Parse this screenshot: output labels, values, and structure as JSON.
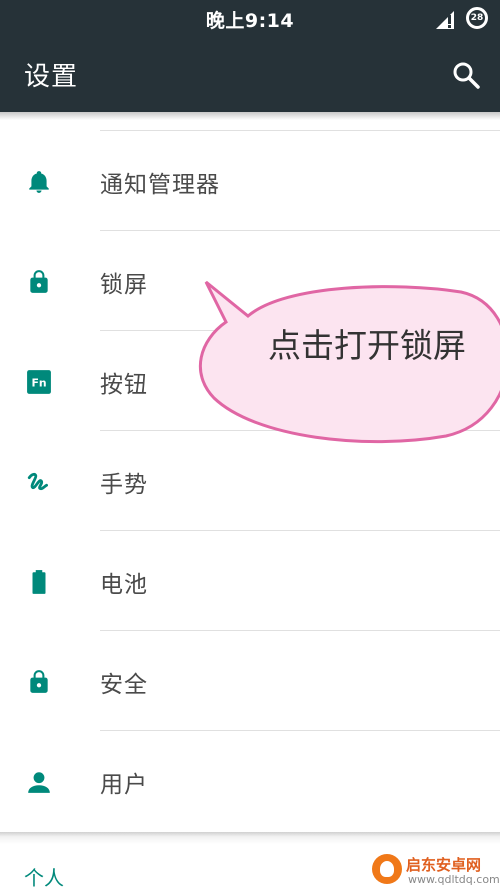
{
  "status_bar": {
    "time": "晚上9:14",
    "battery_level": "28"
  },
  "app_bar": {
    "title": "设置",
    "search_icon": "search-icon"
  },
  "items": [
    {
      "label": "通知管理器",
      "icon": "bell-icon"
    },
    {
      "label": "锁屏",
      "icon": "lock-icon"
    },
    {
      "label": "按钮",
      "icon": "fn-key-icon"
    },
    {
      "label": "手势",
      "icon": "gesture-icon"
    },
    {
      "label": "电池",
      "icon": "battery-icon"
    },
    {
      "label": "安全",
      "icon": "lock-icon"
    },
    {
      "label": "用户",
      "icon": "person-icon"
    }
  ],
  "section_header": "个人",
  "callout": {
    "text": "点击打开锁屏"
  },
  "watermark": {
    "title": "启东安卓网",
    "url": "www.qdltdq.com"
  },
  "colors": {
    "app_bar": "#263238",
    "icon": "#00897b",
    "callout_fill": "#fce4f0",
    "callout_border": "#e066a4"
  }
}
